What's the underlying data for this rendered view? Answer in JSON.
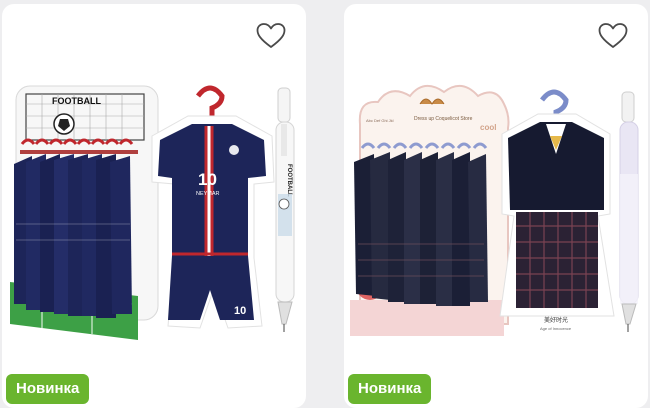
{
  "products": [
    {
      "badge": "Новинка",
      "image_icon": "football-uniform-pen-display",
      "display_title": "FOOTBALL",
      "jersey_number": "10",
      "jersey_name": "NEYMAR",
      "shorts_number": "10",
      "pen_text": "FOOTBALL"
    },
    {
      "badge": "Новинка",
      "image_icon": "school-uniform-pen-display",
      "display_title": "Dress up Coquelicot Store",
      "display_side_text": "Abc Def Ghi Jkl",
      "display_right_text": "cool",
      "tag_text": "美好时光",
      "tag_subtext": "Age of Innocence"
    }
  ],
  "colors": {
    "badge_bg": "#6ab52e",
    "navy": "#1d2559",
    "red": "#c0272d"
  }
}
